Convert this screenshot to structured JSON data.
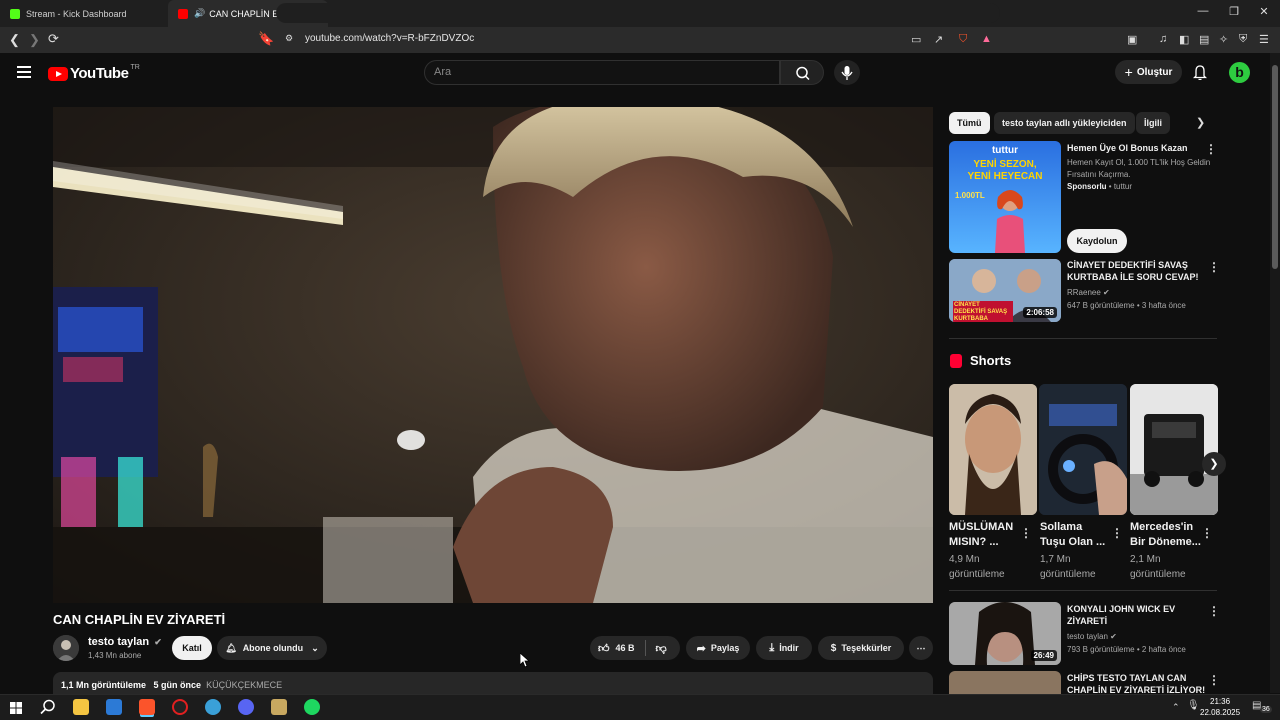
{
  "browser": {
    "tabs": [
      {
        "label": "Stream - Kick Dashboard",
        "favicon_color": "#53fc18"
      },
      {
        "label": "CAN CHAPLİN EV ZİYARETİ - Y",
        "favicon_color": "#ff0000"
      }
    ],
    "url": "youtube.com/watch?v=R-bFZnDVZOc"
  },
  "header": {
    "logo_text": "YouTube",
    "country_code": "TR",
    "search_placeholder": "Ara",
    "create_label": "Oluştur",
    "avatar_letter": "b"
  },
  "video": {
    "title": "CAN CHAPLİN EV ZİYARETİ",
    "channel": "testo taylan",
    "subscribers": "1,43 Mn abone",
    "join_label": "Katıl",
    "subscribed_label": "Abone olundu",
    "likes": "46 B",
    "share_label": "Paylaş",
    "download_label": "İndir",
    "thanks_label": "Teşekkürler",
    "views": "1,1 Mn görüntüleme",
    "age": "5 gün önce",
    "location": "KÜÇÜKÇEKMECE"
  },
  "sidebar": {
    "chips": [
      "Tümü",
      "testo taylan adlı yükleyiciden",
      "İlgili"
    ],
    "ad": {
      "title": "Hemen Üye Ol Bonus Kazan",
      "desc": "Hemen Kayıt Ol, 1.000 TL'lik Hoş Geldin Fırsatını Kaçırma.",
      "sponsored": "Sponsorlu",
      "advertiser": "tuttur",
      "cta": "Kaydolun",
      "thumb_brand": "tuttur",
      "thumb_line1": "YENİ SEZON,",
      "thumb_line2": "YENİ HEYECAN",
      "thumb_bonus": "1.000TL"
    },
    "rec1": {
      "title": "CİNAYET DEDEKTİFİ SAVAŞ KURTBABA İLE SORU CEVAP!",
      "channel": "RRaenee",
      "meta": "647 B görüntüleme • 3 hafta önce",
      "duration": "2:06:58",
      "thumb_caption": "CİNAYET DEDEKTİFİ SAVAŞ KURTBABA"
    },
    "shorts_title": "Shorts",
    "shorts": [
      {
        "title1": "MÜSLÜMAN",
        "title2": "MISIN? ...",
        "views": "4,9 Mn",
        "views2": "görüntüleme"
      },
      {
        "title1": "Sollama",
        "title2": "Tuşu Olan ...",
        "views": "1,7 Mn",
        "views2": "görüntüleme"
      },
      {
        "title1": "Mercedes'in",
        "title2": "Bir Döneme...",
        "views": "2,1 Mn",
        "views2": "görüntüleme"
      }
    ],
    "rec2": {
      "title": "KONYALI JOHN WICK EV ZİYARETİ",
      "channel": "testo taylan",
      "meta": "793 B görüntüleme • 2 hafta önce",
      "duration": "26:49"
    },
    "rec3": {
      "title": "CHİPS TESTO TAYLAN CAN CHAPLİN EV ZİYARETİ İZLİYOR!"
    }
  },
  "taskbar": {
    "time": "21:36",
    "date": "22.08.2025",
    "notif_count": "36"
  }
}
